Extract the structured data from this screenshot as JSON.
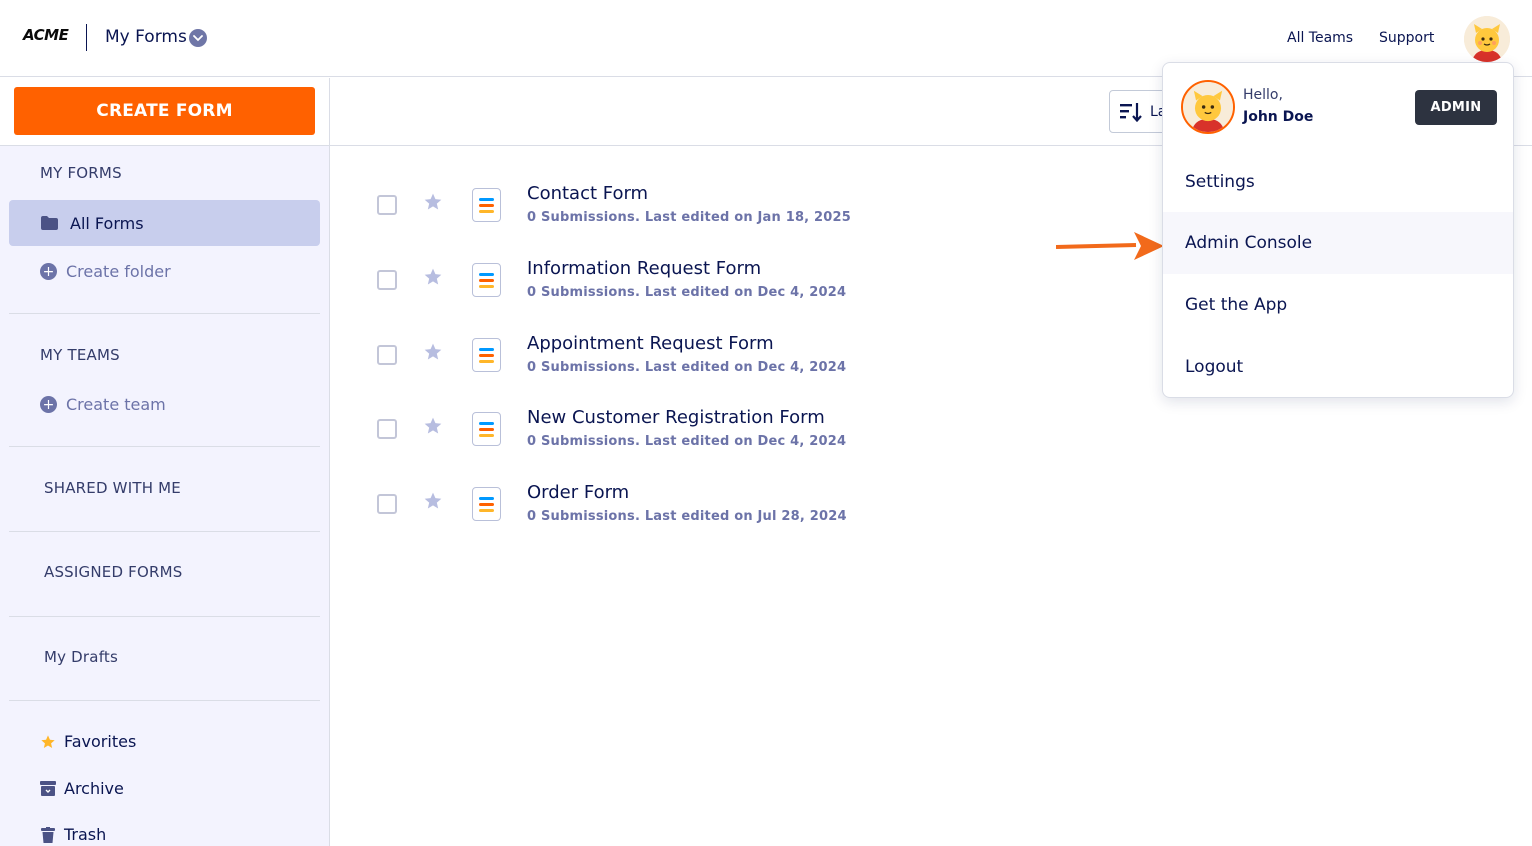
{
  "header": {
    "logo": "ACME",
    "title": "My Forms",
    "links": [
      "All Teams",
      "Support"
    ]
  },
  "sidebar": {
    "create_button": "CREATE FORM",
    "my_forms_heading": "MY FORMS",
    "all_forms": "All Forms",
    "create_folder": "Create folder",
    "my_teams_heading": "MY TEAMS",
    "create_team": "Create team",
    "shared_with_me": "SHARED WITH ME",
    "assigned_forms": "ASSIGNED FORMS",
    "my_drafts": "My Drafts",
    "favorites": "Favorites",
    "archive": "Archive",
    "trash": "Trash"
  },
  "toolbar": {
    "sort_label": "La"
  },
  "forms": [
    {
      "title": "Contact Form",
      "meta": "0 Submissions. Last edited on Jan 18, 2025"
    },
    {
      "title": "Information Request Form",
      "meta": "0 Submissions. Last edited on Dec 4, 2024"
    },
    {
      "title": "Appointment Request Form",
      "meta": "0 Submissions. Last edited on Dec 4, 2024"
    },
    {
      "title": "New Customer Registration Form",
      "meta": "0 Submissions. Last edited on Dec 4, 2024"
    },
    {
      "title": "Order Form",
      "meta": "0 Submissions. Last edited on Jul 28, 2024"
    }
  ],
  "user_menu": {
    "hello": "Hello,",
    "name": "John Doe",
    "badge": "ADMIN",
    "items": [
      "Settings",
      "Admin Console",
      "Get the App",
      "Logout"
    ]
  },
  "colors": {
    "accent": "#ff6100",
    "navy": "#0a1551",
    "sidebar_bg": "#f3f3fe",
    "active_item": "#c8ceed"
  }
}
